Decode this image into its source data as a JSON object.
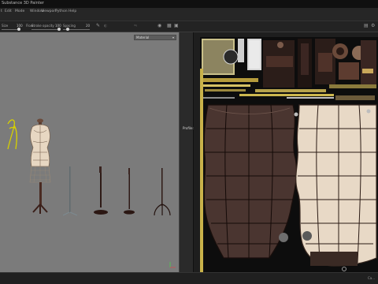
{
  "app": {
    "title": "Substance 3D Painter"
  },
  "menu": {
    "items": [
      "t",
      "Edit",
      "Mode",
      "Window",
      "Viewport",
      "Python",
      "Help"
    ]
  },
  "toolbar": {
    "size_label": "Size",
    "size_value": "100",
    "flow_label": "Flow",
    "flow_value": "100",
    "stroke_opacity_label": "Stroke opacity",
    "stroke_opacity_value": "100",
    "spacing_label": "Spacing",
    "spacing_value": "20"
  },
  "viewport3d": {
    "display_mode": "Material",
    "icons": {
      "dropdown": "chevron-down-icon",
      "axis": "axis-gizmo-icon"
    }
  },
  "viewport2d": {
    "uv_label": "Profile: ACES 1.2 Linear"
  },
  "status": {
    "text": "Ca..."
  },
  "colors": {
    "viewport_bg": "#7b7b7b",
    "panel_bg": "#1e1e1e",
    "accent_yellow": "#c9c400",
    "dark_leather": "#3a2a25",
    "light_leather": "#e9dccb"
  }
}
